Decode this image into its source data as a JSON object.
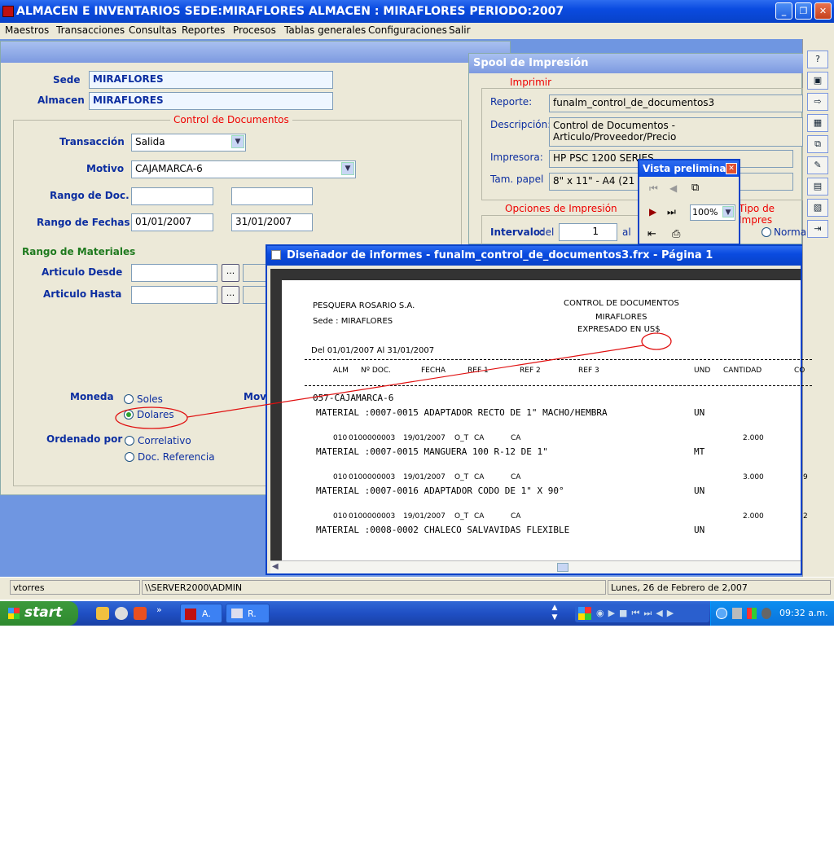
{
  "window": {
    "title": "ALMACEN E INVENTARIOS  SEDE:MIRAFLORES  ALMACEN : MIRAFLORES  PERIODO:2007"
  },
  "menu": [
    "Maestros",
    "Transacciones",
    "Consultas",
    "Reportes",
    "Procesos",
    "Tablas generales",
    "Configuraciones",
    "Salir"
  ],
  "form": {
    "sede_label": "Sede",
    "sede_value": "MIRAFLORES",
    "almacen_label": "Almacen",
    "almacen_value": "MIRAFLORES",
    "control_legend": "Control de Documentos",
    "transaccion_label": "Transacción",
    "transaccion_value": "Salida",
    "motivo_label": "Motivo",
    "motivo_value": "CAJAMARCA-6",
    "rango_doc_label": "Rango de Doc.",
    "rango_doc_from": "",
    "rango_doc_to": "",
    "rango_fechas_label": "Rango de Fechas",
    "fecha_desde": "01/01/2007",
    "fecha_hasta": "31/01/2007",
    "rango_materiales_label": "Rango de Materiales",
    "articulo_desde_label": "Articulo Desde",
    "articulo_hasta_label": "Articulo Hasta",
    "browse_label": "...",
    "moneda_label": "Moneda",
    "moneda_soles": "Soles",
    "moneda_dolares": "Dolares",
    "movi_label": "Movi",
    "ordenado_label": "Ordenado por",
    "orden_correlativo": "Correlativo",
    "orden_doc_ref": "Doc. Referencia"
  },
  "spool": {
    "title": "Spool de Impresión",
    "imprimir_legend": "Imprimir",
    "reporte_label": "Reporte:",
    "reporte_value": "funalm_control_de_documentos3",
    "descripcion_label": "Descripción:",
    "descripcion_value": "Control de Documentos - Articulo/Proveedor/Precio",
    "impresora_label": "Impresora:",
    "impresora_value": "HP PSC 1200 SERIES",
    "papel_label": "Tam. papel",
    "papel_value": "8\" x 11\" - A4 (21 x 29,7 cm)",
    "opciones_legend": "Opciones de Impresión",
    "tipo_legend": "Tipo de Impres",
    "intervalo_label": "Intervalo:",
    "del_label": "del",
    "del_value": "1",
    "al_label": "al",
    "normal_label": "Norma"
  },
  "vista": {
    "title": "Vista preliminar",
    "zoom": "100%"
  },
  "designer": {
    "title": "Diseñador de informes - funalm_control_de_documentos3.frx - Página 1",
    "company": "PESQUERA ROSARIO S.A.",
    "sede": "Sede : MIRAFLORES",
    "report_title": "CONTROL DE DOCUMENTOS",
    "report_subtitle": "MIRAFLORES",
    "currency_note": "EXPRESADO EN US$",
    "period": "Del 01/01/2007 Al 31/01/2007",
    "columns": [
      "ALM",
      "Nº DOC.",
      "FECHA",
      "REF 1",
      "REF 2",
      "REF 3",
      "UND",
      "CANTIDAD",
      "CO"
    ],
    "group": "057-CAJAMARCA-6",
    "rows": [
      {
        "material": "MATERIAL :0007-0015 ADAPTADOR RECTO DE 1\" MACHO/HEMBRA",
        "und": "UN",
        "detail": {
          "alm": "010",
          "doc": "0100000003",
          "fecha": "19/01/2007",
          "ref1": "O_T",
          "ref2": "CA",
          "ref3": "CA",
          "cantidad": "2.000",
          "co": ""
        }
      },
      {
        "material": "MATERIAL :0007-0015 MANGUERA 100 R-12 DE 1\"",
        "und": "MT",
        "detail": {
          "alm": "010",
          "doc": "0100000003",
          "fecha": "19/01/2007",
          "ref1": "O_T",
          "ref2": "CA",
          "ref3": "CA",
          "cantidad": "3.000",
          "co": "9"
        }
      },
      {
        "material": "MATERIAL :0007-0016 ADAPTADOR CODO DE 1\" X 90°",
        "und": "UN",
        "detail": {
          "alm": "010",
          "doc": "0100000003",
          "fecha": "19/01/2007",
          "ref1": "O_T",
          "ref2": "CA",
          "ref3": "CA",
          "cantidad": "2.000",
          "co": "2"
        }
      },
      {
        "material": "MATERIAL :0008-0002 CHALECO SALVAVIDAS FLEXIBLE",
        "und": "UN"
      }
    ]
  },
  "status": {
    "user": "vtorres",
    "server": "\\\\SERVER2000\\ADMIN",
    "date": "Lunes, 26 de Febrero de 2,007"
  },
  "taskbar": {
    "start": "start",
    "task1": "A.",
    "task2": "R.",
    "clock": "09:32 a.m."
  }
}
